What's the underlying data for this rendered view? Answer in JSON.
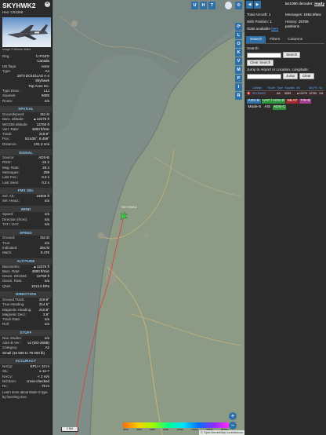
{
  "info": {
    "callsign": "SKYHWK2",
    "hex_label": "Hex:",
    "hex": "C01266",
    "close": "×",
    "photo_credit": "Image © Werner Wiehl",
    "top_rows": [
      {
        "k": "Reg.:",
        "v": "C-FGZO"
      },
      {
        "k": "",
        "v": "Canada"
      },
      {
        "k": "DB flags:",
        "v": "none"
      },
      {
        "k": "Type:",
        "v": "A4"
      },
      {
        "k": "",
        "v": "1973 DOUGLAS A-4"
      },
      {
        "k": "",
        "v": "Skyhawk"
      },
      {
        "k": "",
        "v": "Top Aces Inc."
      },
      {
        "k": "Type Desc.:",
        "v": "L1J"
      },
      {
        "k": "Squawk:",
        "v": "5055"
      },
      {
        "k": "Route:",
        "v": "n/a"
      }
    ],
    "spatial_title": "SPATIAL",
    "spatial": [
      {
        "k": "Groundspeed:",
        "v": "311 kt"
      },
      {
        "k": "Baro. altitude:",
        "v": "▲12275 ft"
      },
      {
        "k": "WGS84 altitude:",
        "v": "12750 ft"
      },
      {
        "k": "Vert. Rate:",
        "v": "4800 ft/min"
      },
      {
        "k": "Track:",
        "v": "219.9°"
      },
      {
        "k": "Pos.:",
        "v": "53.635°, 8.458°"
      },
      {
        "k": "Distance:",
        "v": "101.3 nmi"
      }
    ],
    "signal_title": "SIGNAL",
    "signal": [
      {
        "k": "Source:",
        "v": "ADS-B"
      },
      {
        "k": "RSSI:",
        "v": "-22.2"
      },
      {
        "k": "Msg. Rate:",
        "v": "20.4"
      },
      {
        "k": "Messages:",
        "v": "209"
      },
      {
        "k": "Last Pos.:",
        "v": "0.2 s"
      },
      {
        "k": "Last Seen:",
        "v": "0.2 s"
      }
    ],
    "fms_title": "FMS SEL",
    "fms": [
      {
        "k": "Sel. Alt.:",
        "v": "24000 ft"
      },
      {
        "k": "Sel. Head.:",
        "v": "n/a"
      }
    ],
    "wind_title": "WIND",
    "wind": [
      {
        "k": "Speed:",
        "v": "n/a"
      },
      {
        "k": "Direction (from):",
        "v": "n/a"
      },
      {
        "k": "TAT / OAT:",
        "v": "n/a"
      }
    ],
    "speed_title": "SPEED",
    "speed": [
      {
        "k": "Ground:",
        "v": "311 kt"
      },
      {
        "k": "True:",
        "v": "n/a"
      },
      {
        "k": "Indicated:",
        "v": "254 kt"
      },
      {
        "k": "Mach:",
        "v": "0.476"
      }
    ],
    "altitude_title": "ALTITUDE",
    "altitude": [
      {
        "k": "Barometric:",
        "v": "▲12275 ft"
      },
      {
        "k": "Baro. Rate:",
        "v": "4800 ft/min"
      },
      {
        "k": "Geom. WGS84:",
        "v": "12750 ft"
      },
      {
        "k": "Geom. Rate:",
        "v": "n/a"
      },
      {
        "k": "QNH:",
        "v": "1013.6 hPa"
      }
    ],
    "direction_title": "DIRECTION",
    "direction": [
      {
        "k": "Ground Track:",
        "v": "219.9°"
      },
      {
        "k": "True Heading:",
        "v": "214.5°"
      },
      {
        "k": "Magnetic Heading:",
        "v": "210.8°"
      },
      {
        "k": "Magnetic Decl.:",
        "v": "3.9°"
      },
      {
        "k": "Track Rate:",
        "v": "n/a"
      },
      {
        "k": "Roll:",
        "v": "n/a"
      }
    ],
    "stuff_title": "STUFF",
    "stuff": [
      {
        "k": "Nav. Modes:",
        "v": "n/a"
      },
      {
        "k": "ADS-B Ver.:",
        "v": "v2 (DO-260B)"
      },
      {
        "k": "Category:",
        "v": "A2"
      }
    ],
    "category_desc": "Small (15 500 to 75 000 lb)",
    "accuracy_title": "ACCURACY",
    "accuracy": [
      {
        "k": "NACp:",
        "v": "EPU < 10 m"
      },
      {
        "k": "SIL:",
        "v": "≤ 1e-7"
      },
      {
        "k": "NACv:",
        "v": "< 3 m/s"
      },
      {
        "k": "NICbaro:",
        "v": "cross-checked"
      },
      {
        "k": "Rc:",
        "v": "75 m"
      }
    ],
    "footer_note": "Learn more about Mode S type by hovering over"
  },
  "map": {
    "top_buttons": [
      "U",
      "H",
      "T"
    ],
    "side_buttons": [
      "L",
      "O",
      "K",
      "V",
      "M",
      "P",
      "I",
      "R"
    ],
    "zoom_in": "+",
    "zoom_out": "−",
    "scale": "2 NM",
    "legend_labels": [
      "2000",
      "4000",
      "6000",
      "8000",
      "10000",
      "20000",
      "30000",
      "40000+"
    ],
    "attribution": "© OpenStreetMap contributors",
    "place_labels": [
      "Cuxhaven",
      "Bremerhaven",
      "Otterndorf",
      "Geestland",
      "Wurster Nordseeküste",
      "Nordholz",
      "Langen"
    ],
    "aircraft_label": "SKYHWK2",
    "colors": {
      "water": "#7f8d88",
      "land": "#8d9a86",
      "track": "#e03a3a",
      "roads": "#c8b478",
      "aircraft": "#39d04a"
    }
  },
  "right": {
    "decoder_prefix": "tar1090 decoder:",
    "decoder_status": "ready",
    "arrow_left": "◀",
    "arrow_right": "▶",
    "total_aircraft_label": "Total Aircraft:",
    "total_aircraft": "1",
    "messages_label": "Messages:",
    "messages": "1952.9/sec",
    "with_position_label": "With Position:",
    "with_position": "1",
    "history_label": "History:",
    "history": "25706 positions",
    "stats_available": "Stats available",
    "stats_link": "here",
    "tabs": [
      "Search",
      "Filters",
      "Columns"
    ],
    "search_label": "Search:",
    "search_button": "Search",
    "clear_search_button": "Clear Search",
    "jump_label": "Jump to Airport or Location, Longitude:",
    "jump_button": "Jump",
    "clear_button": "Clear",
    "table_headers": [
      "",
      "Callsign",
      "Route",
      "Type",
      "Squawk",
      "Alt.",
      "Alt.(Ft)",
      "Sp"
    ],
    "table_rows": [
      {
        "flag": "🇨🇦",
        "callsign": "SKYHWK2",
        "route": "",
        "type": "A4",
        "squawk": "5055",
        "alt": "▲12275",
        "alt_ft": "12750",
        "speed": "311"
      }
    ],
    "badges": [
      {
        "label": "ADS-B",
        "color": "#2f6fa8"
      },
      {
        "label": "UAT / ADS-R",
        "color": "#2f8f3a"
      },
      {
        "label": "MLAT",
        "color": "#a02828"
      },
      {
        "label": "TIS-B",
        "color": "#a03c8c"
      },
      {
        "label": "Mode-S",
        "color": "#2b2b2b"
      },
      {
        "label": "AIS",
        "color": "#2b2b2b"
      },
      {
        "label": "ADS-C",
        "color": "#2f8f3a"
      }
    ]
  }
}
